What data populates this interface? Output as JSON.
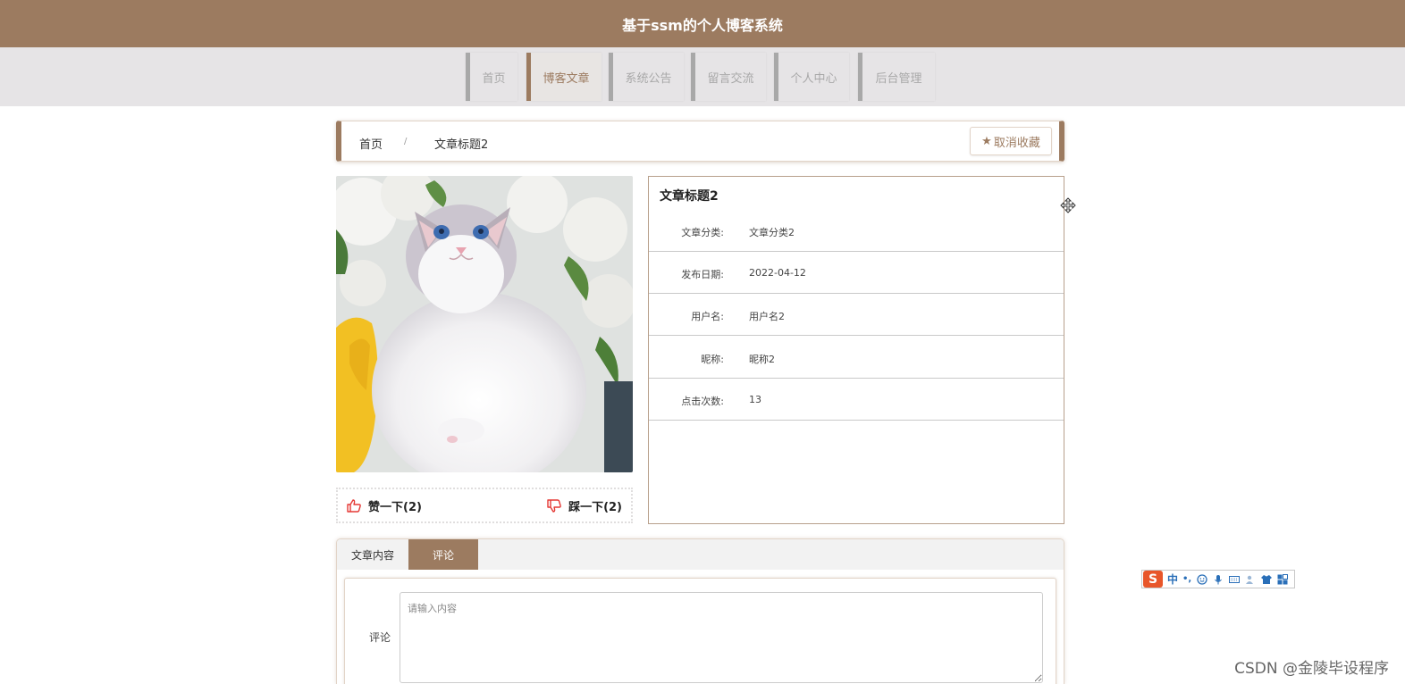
{
  "header": {
    "title": "基于ssm的个人博客系统"
  },
  "nav": {
    "items": [
      {
        "label": "首页"
      },
      {
        "label": "博客文章"
      },
      {
        "label": "系统公告"
      },
      {
        "label": "留言交流"
      },
      {
        "label": "个人中心"
      },
      {
        "label": "后台管理"
      }
    ],
    "active_index": 1
  },
  "breadcrumb": {
    "home": "首页",
    "separator": "/",
    "current": "文章标题2"
  },
  "favorite_button": {
    "label": "取消收藏",
    "icon": "star-icon"
  },
  "votes": {
    "like": {
      "label": "赞一下(2)",
      "icon": "thumbs-up-icon"
    },
    "dislike": {
      "label": "踩一下(2)",
      "icon": "thumbs-down-icon"
    }
  },
  "article": {
    "title": "文章标题2",
    "fields": [
      {
        "label": "文章分类:",
        "value": "文章分类2"
      },
      {
        "label": "发布日期:",
        "value": "2022-04-12"
      },
      {
        "label": "用户名:",
        "value": "用户名2"
      },
      {
        "label": "昵称:",
        "value": "昵称2"
      },
      {
        "label": "点击次数:",
        "value": "13"
      }
    ]
  },
  "tabs": [
    {
      "label": "文章内容",
      "active": false
    },
    {
      "label": "评论",
      "active": true
    }
  ],
  "comment_form": {
    "label": "评论",
    "placeholder": "请输入内容"
  },
  "ime_toolbar": {
    "logo": "S",
    "mode": "中",
    "punct": "•,"
  },
  "watermark": "CSDN @金陵毕设程序",
  "colors": {
    "brand": "#9c7b60",
    "nav_bg": "#e6e4e6",
    "inactive_nav": "#a8a8a8",
    "like_red": "#e53935"
  }
}
